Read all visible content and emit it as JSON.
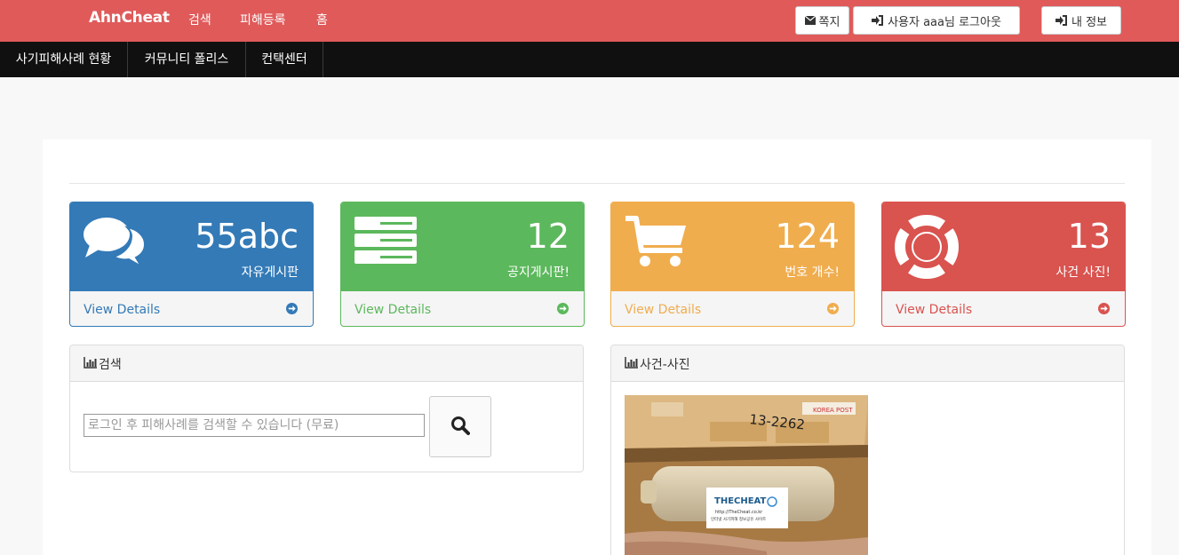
{
  "topbar": {
    "brand": "AhnCheat",
    "nav": [
      "검색",
      "피해등록",
      "홈"
    ],
    "buttons": {
      "messages": "쪽지",
      "logout": "사용자 aaa님 로그아웃",
      "myinfo": "내 정보"
    }
  },
  "subnav": [
    "사기피해사례 현황",
    "커뮤니티 폴리스",
    "컨택센터"
  ],
  "stats": [
    {
      "value": "55abc",
      "label": "자유게시판",
      "link": "View Details",
      "color": "#337ab7",
      "icon": "comments-icon"
    },
    {
      "value": "12",
      "label": "공지게시판!",
      "link": "View Details",
      "color": "#5cb85c",
      "icon": "server-icon"
    },
    {
      "value": "124",
      "label": "번호 개수!",
      "link": "View Details",
      "color": "#f0ad4e",
      "icon": "shopping-cart-icon"
    },
    {
      "value": "13",
      "label": "사건 사진!",
      "link": "View Details",
      "color": "#d9534f",
      "icon": "life-ring-icon"
    }
  ],
  "search_box": {
    "title": "검색",
    "placeholder": "로그인 후 피해사례를 검색할 수 있습니다 (무료)"
  },
  "photo_box": {
    "title": "사건-사진",
    "photo_texts": {
      "courier": "KOREA POST",
      "handwritten": "13-2262",
      "label_brand": "THECHEAT",
      "label_url": "http://TheCheat.co.kr",
      "label_caption": "인터넷 사기피해 정보공유 사이트"
    }
  }
}
